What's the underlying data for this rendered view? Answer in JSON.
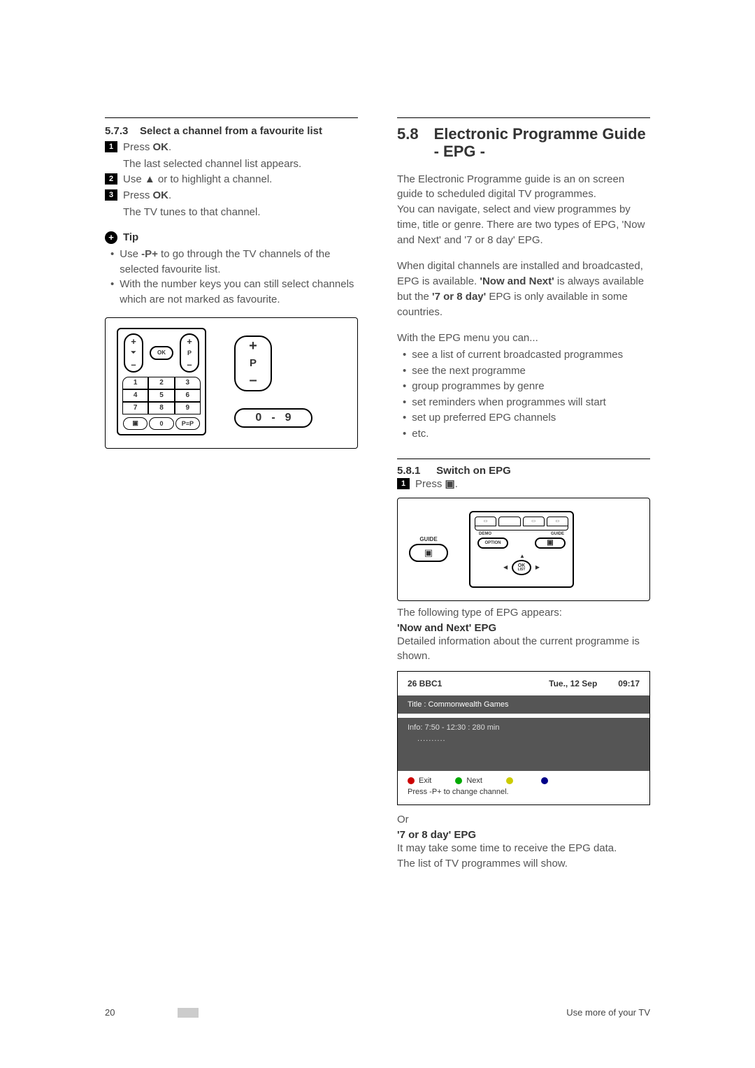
{
  "left": {
    "sec573": {
      "num": "5.7.3",
      "title": "Select a channel from a favourite list",
      "step1a": "Press ",
      "step1b": "OK",
      "step1c": ".",
      "step1_after": "The last selected channel list appears.",
      "step2a": "Use ",
      "step2b": "▲",
      "step2c": " or to highlight a channel.",
      "step3a": "Press ",
      "step3b": "OK",
      "step3c": ".",
      "step3_after": "The TV tunes to that channel."
    },
    "tip": {
      "icon": "+",
      "label": "Tip",
      "b1a": "Use ",
      "b1b": "-P+",
      "b1c": " to go through the TV channels of the selected favourite list.",
      "b2": "With the number keys you can still select channels which are not marked as favourite."
    },
    "remote": {
      "plus": "+",
      "minus": "–",
      "p": "P",
      "ok": "OK",
      "n1": "1",
      "n2": "2",
      "n3": "3",
      "n4": "4",
      "n5": "5",
      "n6": "6",
      "n7": "7",
      "n8": "8",
      "n9": "9",
      "n0": "0",
      "pip": "P≡P",
      "callout_p_top": "+",
      "callout_p_mid": "P",
      "callout_p_bot": "–",
      "callout_09_a": "0",
      "callout_09_dash": "-",
      "callout_09_b": "9"
    }
  },
  "right": {
    "h2num": "5.8",
    "h2title": "Electronic Programme Guide - EPG -",
    "intro1": "The Electronic Programme guide is an on screen guide to scheduled digital TV programmes.",
    "intro2": "You can navigate, select and view programmes by time, title or genre. There are two types of EPG, 'Now and Next' and '7 or 8 day' EPG.",
    "intro3a": "When digital channels are installed and broadcasted, EPG is available. ",
    "intro3b": "'Now and Next'",
    "intro3c": " is always available but the ",
    "intro3d": "'7 or 8 day'",
    "intro3e": " EPG is only available in some countries.",
    "featlead": "With the EPG menu you can...",
    "feat": [
      "see a list of current broadcasted programmes",
      "see the next programme",
      "group programmes by genre",
      "set reminders when programmes will start",
      "set up preferred EPG channels",
      "etc."
    ],
    "sec581": {
      "num": "5.8.1",
      "title": "Switch on EPG",
      "step1a": "Press ",
      "step1b": "▣",
      "step1c": "."
    },
    "guidefig": {
      "guide_label": "GUIDE",
      "guide_glyph": "▣",
      "demo": "DEMO",
      "guide2": "GUIDE",
      "option": "OPTION",
      "ok": "OK",
      "list": "LIST"
    },
    "after_guide": "The following type of EPG appears:",
    "nn_title": "'Now and Next' EPG",
    "nn_desc": "Detailed information about the current programme is shown.",
    "epg": {
      "ch": "26  BBC1",
      "date": "Tue., 12 Sep",
      "time": "09:17",
      "title": "Title : Commonwealth Games",
      "info": "Info: 7:50 - 12:30 : 280 min",
      "dots": "..........",
      "exit": "Exit",
      "next": "Next",
      "foot": "Press -P+ to change channel."
    },
    "or": "Or",
    "d78_title": "'7 or 8 day' EPG",
    "d78_l1": "It may take some time to receive the EPG data.",
    "d78_l2": "The list of TV programmes will show."
  },
  "footer": {
    "page": "20",
    "section": "Use more of your TV"
  }
}
